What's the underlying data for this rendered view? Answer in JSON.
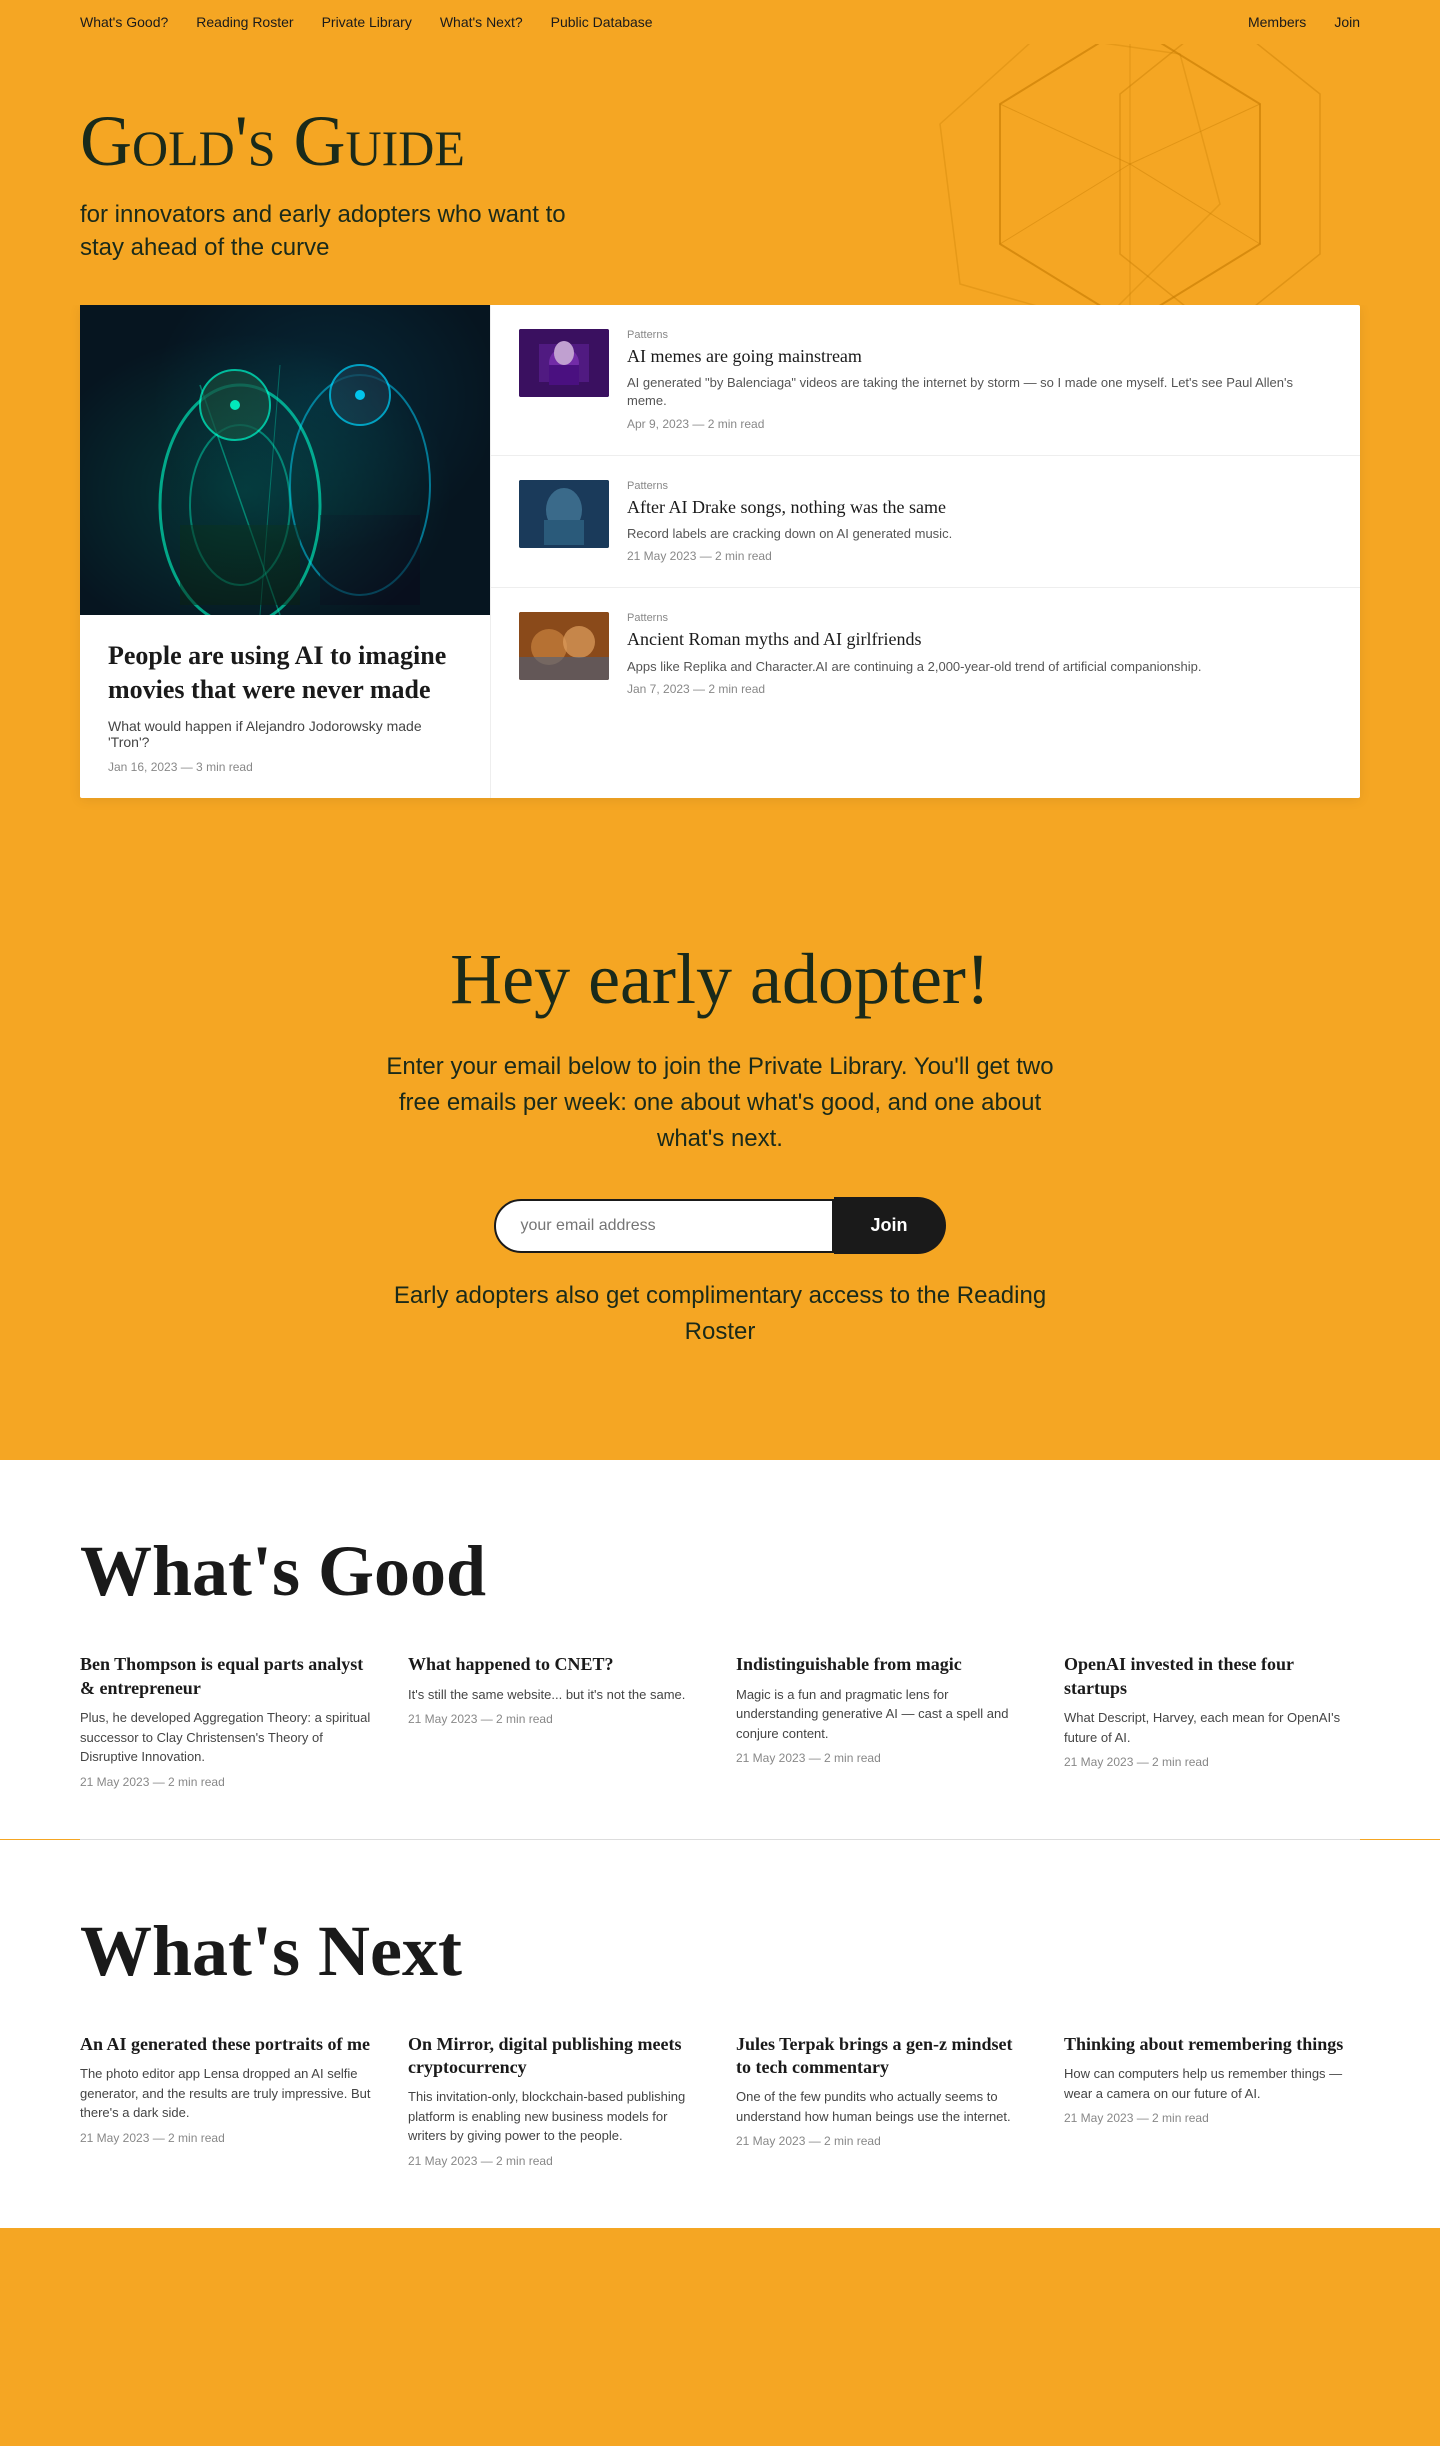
{
  "nav": {
    "left": [
      {
        "label": "What's Good?",
        "href": "#"
      },
      {
        "label": "Reading Roster",
        "href": "#"
      },
      {
        "label": "Private Library",
        "href": "#"
      },
      {
        "label": "What's Next?",
        "href": "#"
      },
      {
        "label": "Public Database",
        "href": "#"
      }
    ],
    "right": [
      {
        "label": "Members",
        "href": "#"
      },
      {
        "label": "Join",
        "href": "#"
      }
    ]
  },
  "hero": {
    "title": "Gold's Guide",
    "subtitle": "for innovators and early adopters who want to stay ahead of the curve"
  },
  "featured_article": {
    "title": "People are using AI to imagine movies that were never made",
    "description": "What would happen if Alejandro Jodorowsky made 'Tron'?",
    "meta": "Jan 16, 2023 — 3 min read"
  },
  "articles": [
    {
      "tag": "Patterns",
      "title": "AI memes are going mainstream",
      "description": "AI generated \"by Balenciaga\" videos are taking the internet by storm — so I made one myself. Let's see Paul Allen's meme.",
      "meta": "Apr 9, 2023 — 2 min read",
      "thumb_class": "thumb-1"
    },
    {
      "tag": "Patterns",
      "title": "After AI Drake songs, nothing was the same",
      "description": "Record labels are cracking down on AI generated music.",
      "meta": "21 May 2023 — 2 min read",
      "thumb_class": "thumb-2"
    },
    {
      "tag": "Patterns",
      "title": "Ancient Roman myths and AI girlfriends",
      "description": "Apps like Replika and Character.AI are continuing a 2,000-year-old trend of artificial companionship.",
      "meta": "Jan 7, 2023 — 2 min read",
      "thumb_class": "thumb-3"
    }
  ],
  "cta": {
    "heading": "Hey early adopter!",
    "body": "Enter your email below to join the Private Library. You'll get two free emails per week: one about what's good, and one about what's next.",
    "email_placeholder": "your email address",
    "button_label": "Join",
    "footnote": "Early adopters also get complimentary access to the ",
    "footnote_link": "Reading Roster"
  },
  "whats_good": {
    "heading": "What's Good",
    "articles": [
      {
        "title": "Ben Thompson is equal parts analyst & entrepreneur",
        "description": "Plus, he developed Aggregation Theory: a spiritual successor to Clay Christensen's Theory of Disruptive Innovation.",
        "meta": "21 May 2023 — 2 min read"
      },
      {
        "title": "What happened to CNET?",
        "description": "It's still the same website... but it's not the same.",
        "meta": "21 May 2023 — 2 min read"
      },
      {
        "title": "Indistinguishable from magic",
        "description": "Magic is a fun and pragmatic lens for understanding generative AI — cast a spell and conjure content.",
        "meta": "21 May 2023 — 2 min read"
      },
      {
        "title": "OpenAI invested in these four startups",
        "description": "What Descript, Harvey, each mean for OpenAI's future of AI.",
        "meta": "21 May 2023 — 2 min read"
      }
    ]
  },
  "whats_next": {
    "heading": "What's Next",
    "articles": [
      {
        "title": "An AI generated these portraits of me",
        "description": "The photo editor app Lensa dropped an AI selfie generator, and the results are truly impressive. But there's a dark side.",
        "meta": "21 May 2023 — 2 min read"
      },
      {
        "title": "On Mirror, digital publishing meets cryptocurrency",
        "description": "This invitation-only, blockchain-based publishing platform is enabling new business models for writers by giving power to the people.",
        "meta": "21 May 2023 — 2 min read"
      },
      {
        "title": "Jules Terpak brings a gen-z mindset to tech commentary",
        "description": "One of the few pundits who actually seems to understand how human beings use the internet.",
        "meta": "21 May 2023 — 2 min read"
      },
      {
        "title": "Thinking about remembering things",
        "description": "How can computers help us remember things — wear a camera on our future of AI.",
        "meta": "21 May 2023 — 2 min read"
      }
    ]
  }
}
